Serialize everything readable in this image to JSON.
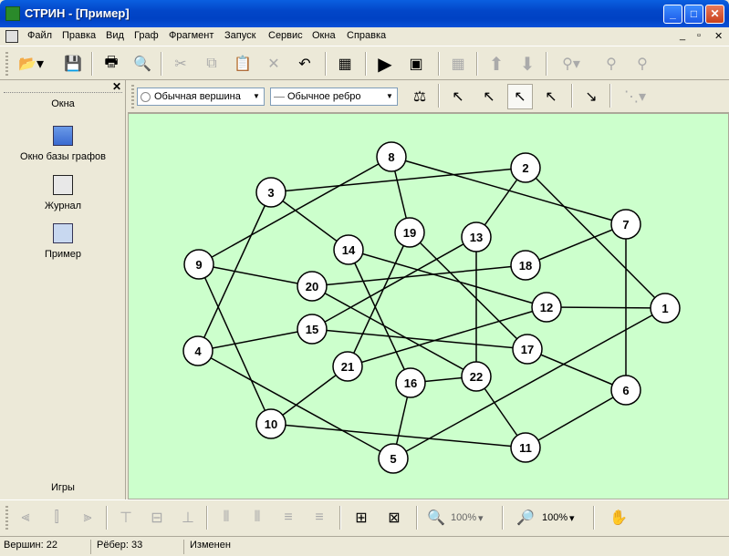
{
  "window": {
    "title": "СТРИН - [Пример]",
    "minimize": "_",
    "maximize": "□",
    "close": "✕"
  },
  "menu": [
    "Файл",
    "Правка",
    "Вид",
    "Граф",
    "Фрагмент",
    "Запуск",
    "Сервис",
    "Окна",
    "Справка"
  ],
  "mdi_controls": [
    "_",
    "▫",
    "✕"
  ],
  "side_panel": {
    "title": "Окна",
    "items": [
      "Окно базы графов",
      "Журнал",
      "Пример"
    ],
    "footer": "Игры",
    "close": "✕"
  },
  "toolbar2": {
    "vertex_type": "Обычная вершина",
    "edge_type": "Обычное ребро"
  },
  "zoom": {
    "zoom1": "100%",
    "zoom2": "100%"
  },
  "status": {
    "vertices": "Вершин: 22",
    "edges": "Рёбер: 33",
    "state": "Изменен"
  },
  "graph": {
    "background": "#ccffcc",
    "vertices": [
      {
        "id": "1"
      },
      {
        "id": "2"
      },
      {
        "id": "3"
      },
      {
        "id": "4"
      },
      {
        "id": "5"
      },
      {
        "id": "6"
      },
      {
        "id": "7"
      },
      {
        "id": "8"
      },
      {
        "id": "9"
      },
      {
        "id": "10"
      },
      {
        "id": "11"
      },
      {
        "id": "12"
      },
      {
        "id": "13"
      },
      {
        "id": "14"
      },
      {
        "id": "15"
      },
      {
        "id": "16"
      },
      {
        "id": "17"
      },
      {
        "id": "18"
      },
      {
        "id": "19"
      },
      {
        "id": "20"
      },
      {
        "id": "21"
      },
      {
        "id": "22"
      }
    ],
    "edges": [
      [
        "8",
        "9"
      ],
      [
        "8",
        "19"
      ],
      [
        "8",
        "7"
      ],
      [
        "3",
        "2"
      ],
      [
        "3",
        "4"
      ],
      [
        "3",
        "14"
      ],
      [
        "2",
        "13"
      ],
      [
        "2",
        "1"
      ],
      [
        "7",
        "6"
      ],
      [
        "7",
        "18"
      ],
      [
        "9",
        "20"
      ],
      [
        "9",
        "10"
      ],
      [
        "14",
        "12"
      ],
      [
        "14",
        "16"
      ],
      [
        "19",
        "17"
      ],
      [
        "19",
        "21"
      ],
      [
        "13",
        "22"
      ],
      [
        "13",
        "15"
      ],
      [
        "18",
        "20"
      ],
      [
        "20",
        "22"
      ],
      [
        "12",
        "1"
      ],
      [
        "12",
        "21"
      ],
      [
        "15",
        "4"
      ],
      [
        "15",
        "17"
      ],
      [
        "17",
        "6"
      ],
      [
        "4",
        "5"
      ],
      [
        "10",
        "11"
      ],
      [
        "10",
        "21"
      ],
      [
        "16",
        "5"
      ],
      [
        "16",
        "22"
      ],
      [
        "22",
        "11"
      ],
      [
        "1",
        "5"
      ],
      [
        "6",
        "11"
      ]
    ]
  }
}
